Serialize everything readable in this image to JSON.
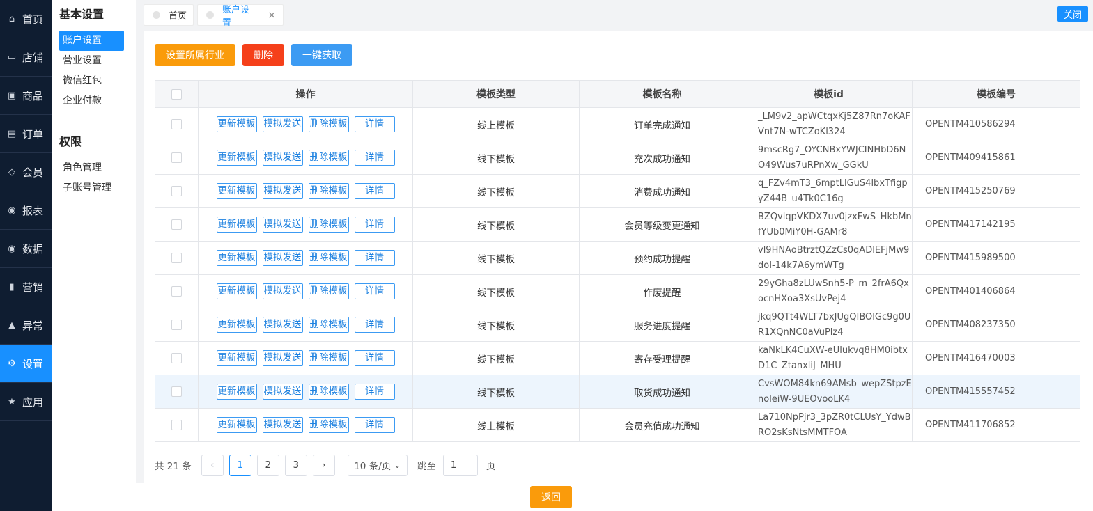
{
  "nav": [
    {
      "label": "首页",
      "icon": "home-icon",
      "glyph": "⌂"
    },
    {
      "label": "店铺",
      "icon": "store-icon",
      "glyph": "▭"
    },
    {
      "label": "商品",
      "icon": "gift-icon",
      "glyph": "▣"
    },
    {
      "label": "订单",
      "icon": "order-icon",
      "glyph": "▤"
    },
    {
      "label": "会员",
      "icon": "member-icon",
      "glyph": "◇"
    },
    {
      "label": "报表",
      "icon": "report-icon",
      "glyph": "◉"
    },
    {
      "label": "数据",
      "icon": "data-icon",
      "glyph": "◉"
    },
    {
      "label": "营销",
      "icon": "bar-chart-icon",
      "glyph": "▮"
    },
    {
      "label": "异常",
      "icon": "warning-icon",
      "glyph": "▲"
    },
    {
      "label": "设置",
      "icon": "gear-icon",
      "glyph": "⚙",
      "active": true
    },
    {
      "label": "应用",
      "icon": "star-icon",
      "glyph": "★"
    }
  ],
  "submenu": {
    "group1_title": "基本设置",
    "group1_items": [
      "账户设置",
      "营业设置",
      "微信红包",
      "企业付款"
    ],
    "group2_title": "权限",
    "group2_items": [
      "角色管理",
      "子账号管理"
    ]
  },
  "tabs": [
    {
      "label": "首页"
    },
    {
      "label": "账户设置",
      "close": "×"
    }
  ],
  "close_button": "关闭",
  "toolbar": {
    "industry": "设置所属行业",
    "delete": "删除",
    "fetch": "一键获取"
  },
  "table": {
    "headers": [
      "操作",
      "模板类型",
      "模板名称",
      "模板id",
      "模板编号"
    ],
    "actions": [
      "更新模板",
      "模拟发送",
      "删除模板",
      "详情"
    ],
    "rows": [
      {
        "type": "线上模板",
        "name": "订单完成通知",
        "id": "_LM9v2_apWCtqxKj5Z87Rn7oKAFVnt7N-wTCZoKl324",
        "no": "OPENTM410586294"
      },
      {
        "type": "线下模板",
        "name": "充次成功通知",
        "id": "9mscRg7_OYCNBxYWJCINHbD6NO49Wus7uRPnXw_GGkU",
        "no": "OPENTM409415861"
      },
      {
        "type": "线下模板",
        "name": "消费成功通知",
        "id": "q_FZv4mT3_6mptLlGuS4lbxTfigpyZ44B_u4Tk0C16g",
        "no": "OPENTM415250769"
      },
      {
        "type": "线下模板",
        "name": "会员等级变更通知",
        "id": "BZQvlqpVKDX7uv0jzxFwS_HkbMnfYUb0MiY0H-GAMr8",
        "no": "OPENTM417142195"
      },
      {
        "type": "线下模板",
        "name": "预约成功提醒",
        "id": "vl9HNAoBtrztQZzCs0qADlEFjMw9doI-14k7A6ymWTg",
        "no": "OPENTM415989500"
      },
      {
        "type": "线下模板",
        "name": "作废提醒",
        "id": "29yGha8zLUwSnh5-P_m_2frA6QxocnHXoa3XsUvPej4",
        "no": "OPENTM401406864"
      },
      {
        "type": "线下模板",
        "name": "服务进度提醒",
        "id": "jkq9QTt4WLT7bxJUgQIBOlGc9g0UR1XQnNC0aVuPlz4",
        "no": "OPENTM408237350"
      },
      {
        "type": "线下模板",
        "name": "寄存受理提醒",
        "id": "kaNkLK4CuXW-eUlukvq8HM0ibtxD1C_ZtanxliJ_MHU",
        "no": "OPENTM416470003"
      },
      {
        "type": "线下模板",
        "name": "取货成功通知",
        "id": "CvsWOM84kn69AMsb_wepZStpzEnoleiW-9UEOvooLK4",
        "no": "OPENTM415557452",
        "highlight": true
      },
      {
        "type": "线上模板",
        "name": "会员充值成功通知",
        "id": "La710NpPjr3_3pZR0tCLUsY_YdwBRO2sKsNtsMMTFOA",
        "no": "OPENTM411706852"
      }
    ]
  },
  "pagination": {
    "total": "共 21 条",
    "prev": "‹",
    "pages": [
      "1",
      "2",
      "3"
    ],
    "current": "1",
    "next": "›",
    "page_size": "10 条/页",
    "page_size_caret": "⌄",
    "jump_label": "跳至",
    "jump_value": "1",
    "jump_suffix": "页"
  },
  "back_button": "返回",
  "colors": {
    "sidebar_bg": "#0f1d31",
    "accent": "#1890ff",
    "orange": "#fa9b0b",
    "red": "#f5401a"
  }
}
